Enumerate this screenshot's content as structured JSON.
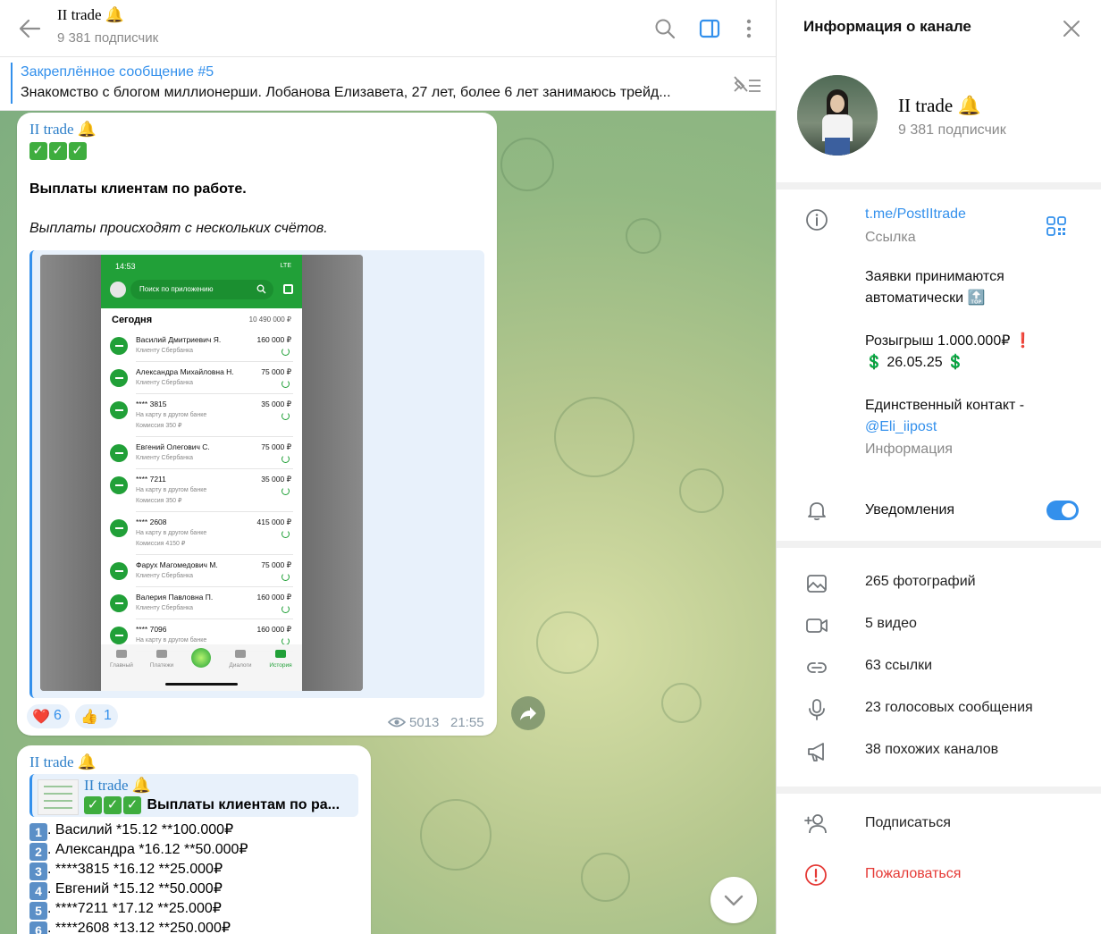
{
  "chat": {
    "title": "II trade 🔔",
    "subscribers": "9 381 подписчик",
    "pinned": {
      "title": "Закреплённое сообщение #5",
      "text": "Знакомство с блогом миллионерши.  Лобанова Елизавета, 27 лет, более 6 лет занимаюсь трейд..."
    }
  },
  "message1": {
    "author": "II trade 🔔",
    "headline": "Выплаты клиентам по работе.",
    "subline": "Выплаты происходят с нескольких счётов.",
    "phone": {
      "time": "14:53",
      "status": "LTE",
      "search_placeholder": "Поиск по приложению",
      "today": "Сегодня",
      "total": "10 490 000 ₽",
      "rows": [
        {
          "name": "Василий Дмитриевич Я.",
          "note": "Клиенту Сбербанка",
          "note2": "",
          "amount": "160 000 ₽"
        },
        {
          "name": "Александра Михайловна Н.",
          "note": "Клиенту Сбербанка",
          "note2": "",
          "amount": "75 000 ₽"
        },
        {
          "name": "**** 3815",
          "note": "На карту в другом банке",
          "note2": "Комиссия 350 ₽",
          "amount": "35 000 ₽"
        },
        {
          "name": "Евгений Олегович С.",
          "note": "Клиенту Сбербанка",
          "note2": "",
          "amount": "75 000 ₽"
        },
        {
          "name": "**** 7211",
          "note": "На карту в другом банке",
          "note2": "Комиссия 350 ₽",
          "amount": "35 000 ₽"
        },
        {
          "name": "**** 2608",
          "note": "На карту в другом банке",
          "note2": "Комиссия 4150 ₽",
          "amount": "415 000 ₽"
        },
        {
          "name": "Фарух Магомедович М.",
          "note": "Клиенту Сбербанка",
          "note2": "",
          "amount": "75 000 ₽"
        },
        {
          "name": "Валерия Павловна П.",
          "note": "Клиенту Сбербанка",
          "note2": "",
          "amount": "160 000 ₽"
        },
        {
          "name": "**** 7096",
          "note": "На карту в другом банке",
          "note2": "",
          "amount": "160 000 ₽"
        }
      ],
      "tabs": [
        "Главный",
        "Платежи",
        "",
        "Диалоги",
        "История"
      ]
    },
    "reactions": [
      {
        "emoji": "❤️",
        "count": "6"
      },
      {
        "emoji": "👍",
        "count": "1"
      }
    ],
    "views": "5013",
    "time": "21:55"
  },
  "message2": {
    "author": "II trade 🔔",
    "forward_author": "II trade 🔔",
    "forward_text": "Выплаты клиентам по ра...",
    "lines": [
      {
        "num": "1",
        "text": ". Василий *15.12 **100.000₽"
      },
      {
        "num": "2",
        "text": ". Александра *16.12 **50.000₽"
      },
      {
        "num": "3",
        "text": ". ****3815 *16.12 **25.000₽"
      },
      {
        "num": "4",
        "text": ". Евгений *15.12 **50.000₽"
      },
      {
        "num": "5",
        "text": ". ****7211 *17.12 **25.000₽"
      },
      {
        "num": "6",
        "text": ". ****2608 *13.12 **250.000₽"
      }
    ]
  },
  "info": {
    "title": "Информация о канале",
    "name": "II trade 🔔",
    "subscribers": "9 381 подписчик",
    "link": "t.me/PostIItrade",
    "link_caption": "Ссылка",
    "desc_line1": "Заявки принимаются",
    "desc_line2": "автоматически 🔝",
    "desc_line3": "Розыгрыш 1.000.000₽ ❗",
    "desc_line4": "💲 26.05.25 💲",
    "desc_line5": "Единственный контакт -",
    "desc_mention": "@Eli_iipost",
    "desc_caption": "Информация",
    "notifications": "Уведомления",
    "notifications_on": true,
    "media": [
      {
        "icon": "photo-icon",
        "label": "265 фотографий"
      },
      {
        "icon": "video-icon",
        "label": "5 видео"
      },
      {
        "icon": "link-icon",
        "label": "63 ссылки"
      },
      {
        "icon": "microphone-icon",
        "label": "23 голосовых сообщения"
      },
      {
        "icon": "megaphone-icon",
        "label": "38 похожих каналов"
      }
    ],
    "subscribe": "Подписаться",
    "report": "Пожаловаться"
  },
  "colors": {
    "accent": "#3390ec",
    "author": "#2d7fc9",
    "danger": "#e53935",
    "sber_green": "#21a038"
  }
}
